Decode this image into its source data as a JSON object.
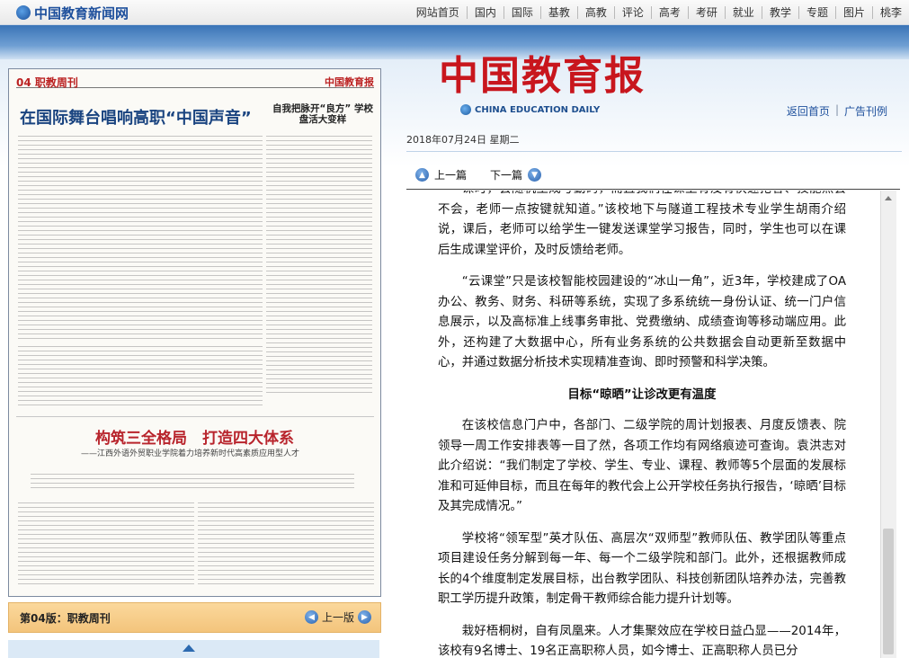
{
  "site_name": "中国教育新闻网",
  "topnav": [
    "网站首页",
    "国内",
    "国际",
    "基教",
    "高教",
    "评论",
    "高考",
    "考研",
    "就业",
    "教学",
    "专题",
    "图片",
    "桃李"
  ],
  "brand": {
    "title": "中国教育报",
    "subtitle": "CHINA EDUCATION DAILY",
    "links": [
      "返回首页",
      "广告刊例"
    ]
  },
  "date_line": "2018年07月24日  星期二",
  "article_nav": {
    "prev": "上一篇",
    "next": "下一篇"
  },
  "newspaper": {
    "page_header": "04 职教周刊",
    "masthead": "中国教育报",
    "title1": "在国际舞台唱响高职“中国声音”",
    "title2": "自我把脉开“良方” 学校盘活大变样",
    "big_title": "构筑三全格局　打造四大体系",
    "sub_title": "——江西外语外贸职业学院着力培养新时代高素质应用型人才"
  },
  "edition": {
    "label": "第04版：职教周刊",
    "prev": "上一版"
  },
  "article": {
    "paragraphs_a": [
      "课时，会随机生成考勤码，而且我们在课上有没有快速抢答、技能点会不会，老师一点按键就知道。”该校地下与隧道工程技术专业学生胡雨介绍说，课后，老师可以给学生一键发送课堂学习报告，同时，学生也可以在课后生成课堂评价，及时反馈给老师。",
      "“云课堂”只是该校智能校园建设的“冰山一角”，近3年，学校建成了OA办公、教务、财务、科研等系统，实现了多系统统一身份认证、统一门户信息展示，以及高标准上线事务审批、党费缴纳、成绩查询等移动端应用。此外，还构建了大数据中心，所有业务系统的公共数据会自动更新至数据中心，并通过数据分析技术实现精准查询、即时预警和科学决策。"
    ],
    "heading": "目标“晾晒”让诊改更有温度",
    "paragraphs_b": [
      "在该校信息门户中，各部门、二级学院的周计划报表、月度反馈表、院领导一周工作安排表等一目了然，各项工作均有网络痕迹可查询。袁洪志对此介绍说：“我们制定了学校、学生、专业、课程、教师等5个层面的发展标准和可延伸目标，而且在每年的教代会上公开学校任务执行报告，‘晾晒’目标及其完成情况。”",
      "学校将“领军型”英才队伍、高层次“双师型”教师队伍、教学团队等重点项目建设任务分解到每一年、每一个二级学院和部门。此外，还根据教师成长的4个维度制定发展目标，出台教学团队、科技创新团队培养办法，完善教职工学历提升政策，制定骨干教师综合能力提升计划等。",
      "栽好梧桐树，自有凤凰来。人才集聚效应在学校日益凸显——2014年，该校有9名博士、19名正高职称人员，如今博士、正高职称人员已分"
    ]
  },
  "icons": [
    "logo-globe-icon",
    "prev-arrow-icon",
    "next-arrow-icon",
    "scroll-up-icon"
  ]
}
